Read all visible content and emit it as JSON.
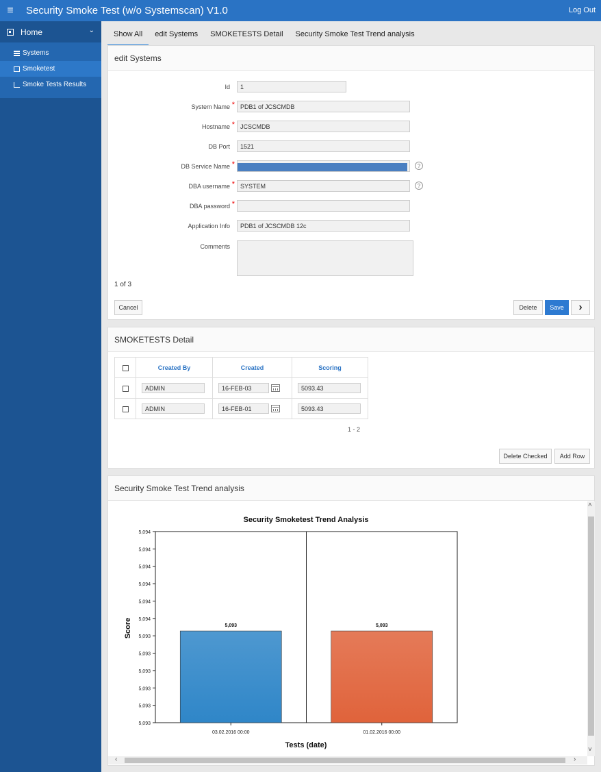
{
  "header": {
    "title": "Security Smoke Test (w/o Systemscan) V1.0",
    "logout_label": "Log Out",
    "menu_icon": "≡"
  },
  "sidebar": {
    "home_label": "Home",
    "items": [
      {
        "label": "Systems"
      },
      {
        "label": "Smoketest"
      },
      {
        "label": "Smoke Tests Results"
      }
    ]
  },
  "tabs": [
    {
      "label": "Show All"
    },
    {
      "label": "edit Systems"
    },
    {
      "label": "SMOKETESTS Detail"
    },
    {
      "label": "Security Smoke Test Trend analysis"
    }
  ],
  "edit_form": {
    "title": "edit Systems",
    "fields": {
      "id": {
        "label": "Id",
        "value": "1"
      },
      "system_name": {
        "label": "System Name",
        "value": "PDB1 of JCSCMDB"
      },
      "hostname": {
        "label": "Hostname",
        "value": "JCSCMDB"
      },
      "db_port": {
        "label": "DB Port",
        "value": "1521"
      },
      "db_service_name": {
        "label": "DB Service Name",
        "value": ""
      },
      "dba_username": {
        "label": "DBA username",
        "value": "SYSTEM"
      },
      "dba_password": {
        "label": "DBA password",
        "value": ""
      },
      "application_info": {
        "label": "Application Info",
        "value": "PDB1 of JCSCMDB 12c"
      },
      "comments": {
        "label": "Comments",
        "value": ""
      }
    },
    "pager": "1 of 3",
    "cancel_label": "Cancel",
    "delete_label": "Delete",
    "save_label": "Save",
    "next_icon": "›",
    "help_icon": "?"
  },
  "smoketests": {
    "title": "SMOKETESTS Detail",
    "columns": [
      "Created By",
      "Created",
      "Scoring"
    ],
    "rows": [
      {
        "created_by": "ADMIN",
        "created": "16-FEB-03",
        "scoring": "5093.43"
      },
      {
        "created_by": "ADMIN",
        "created": "16-FEB-01",
        "scoring": "5093.43"
      }
    ],
    "pagination": "1 - 2",
    "delete_checked_label": "Delete Checked",
    "add_row_label": "Add Row"
  },
  "trend": {
    "title": "Security Smoke Test Trend analysis"
  },
  "chart_data": {
    "type": "bar",
    "title": "Security Smoketest Trend Analysis",
    "xlabel": "Tests (date)",
    "ylabel": "Score",
    "categories": [
      "03.02.2016 00:00",
      "01.02.2016 00:00"
    ],
    "values": [
      5093.43,
      5093.43
    ],
    "value_labels": [
      "5,093",
      "5,093"
    ],
    "y_tick_labels": [
      "5,093",
      "5,093",
      "5,093",
      "5,093",
      "5,093",
      "5,093",
      "5,094",
      "5,094",
      "5,094",
      "5,094",
      "5,094",
      "5,094"
    ],
    "bar_colors": [
      "#2f86c8",
      "#e0633b"
    ],
    "grid": false
  }
}
